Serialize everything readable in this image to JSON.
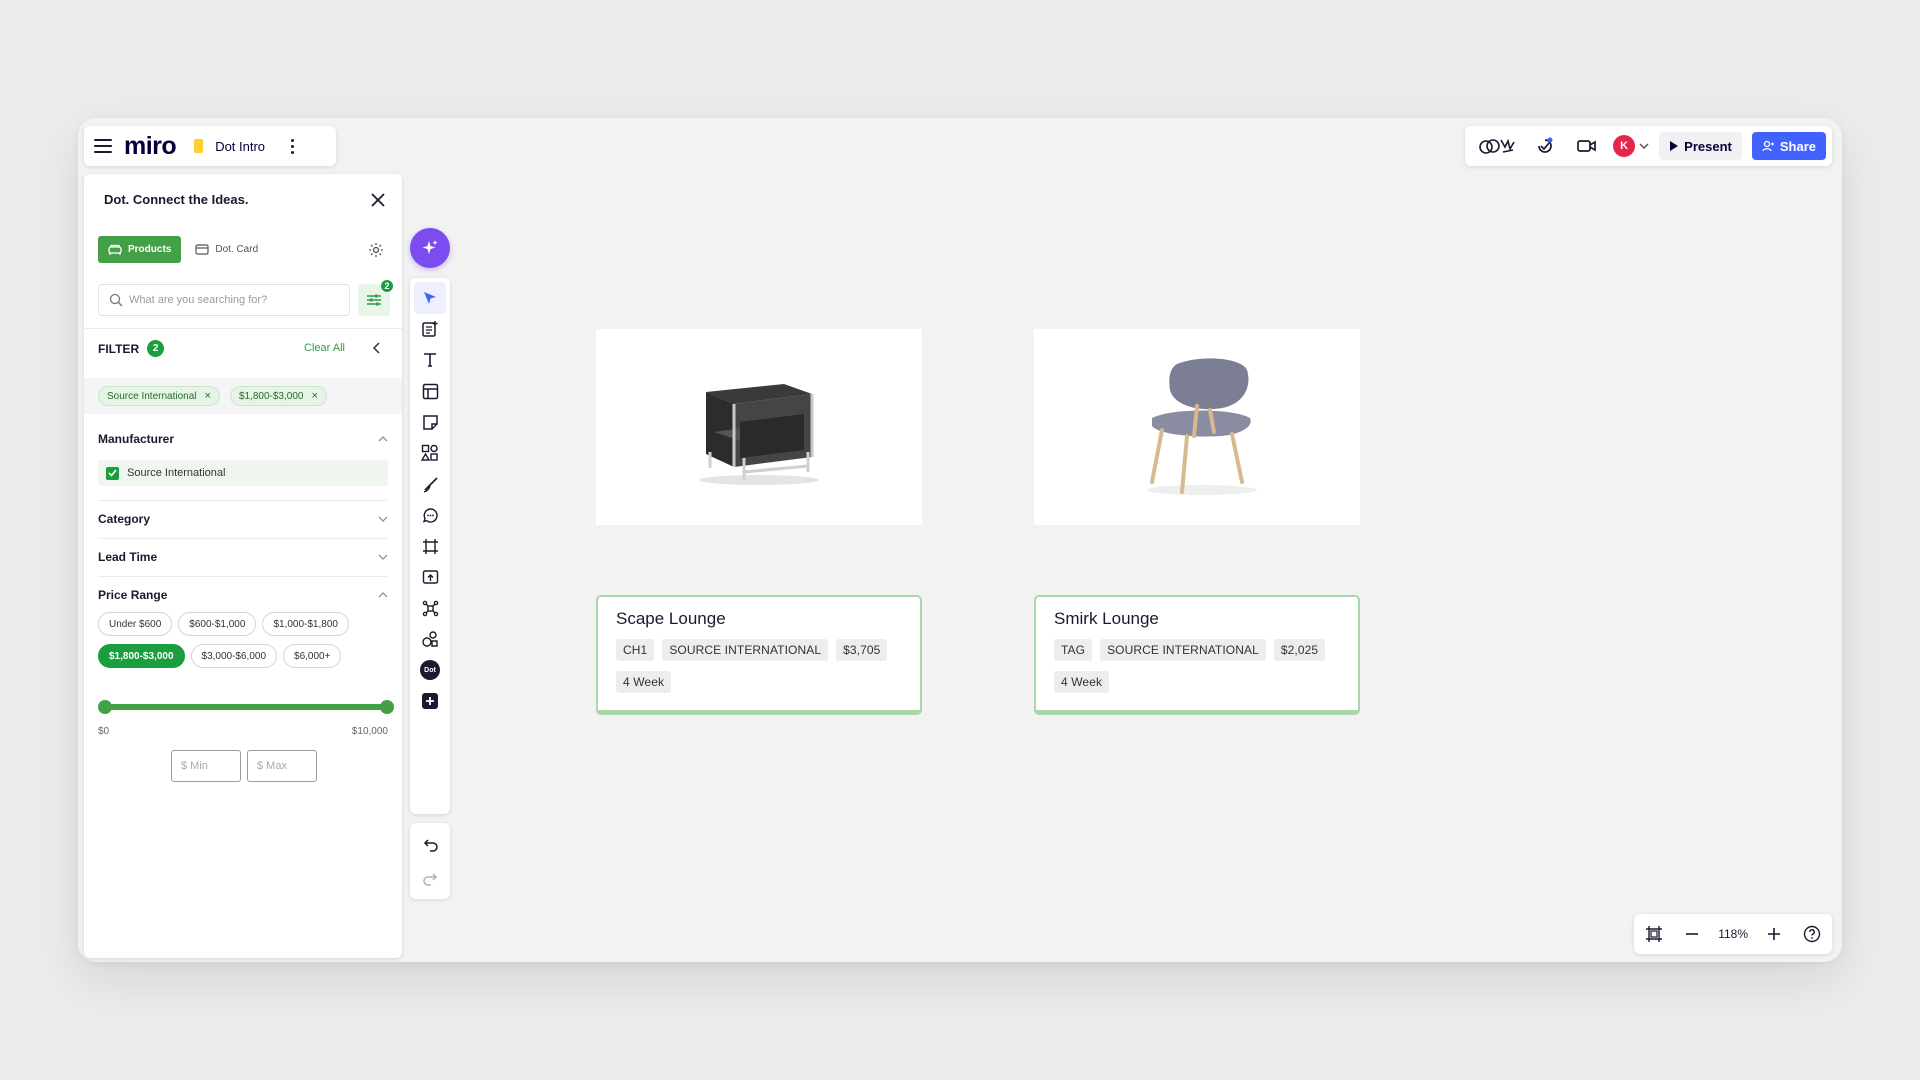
{
  "app": {
    "logo": "miro",
    "board_name": "Dot Intro"
  },
  "topbar": {
    "present_label": "Present",
    "share_label": "Share",
    "avatar_initial": "K"
  },
  "panel": {
    "title": "Dot. Connect the Ideas.",
    "tab_products": "Products",
    "tab_dot_card": "Dot. Card",
    "search_placeholder": "What are you searching for?",
    "filter_badge": "2",
    "filter_label": "FILTER",
    "filter_count": "2",
    "clear_all": "Clear All",
    "active_chips": [
      {
        "label": "Source International",
        "remove": "×"
      },
      {
        "label": "$1,800-$3,000",
        "remove": "×"
      }
    ],
    "manufacturer": {
      "label": "Manufacturer",
      "option": "Source International",
      "checked": true
    },
    "category_label": "Category",
    "lead_time_label": "Lead Time",
    "price_range": {
      "label": "Price Range",
      "chips_row1": [
        "Under $600",
        "$600-$1,000",
        "$1,000-$1,800"
      ],
      "chips_row2": [
        "$1,800-$3,000",
        "$3,000-$6,000",
        "$6,000+"
      ],
      "selected": "$1,800-$3,000",
      "slider_min_label": "$0",
      "slider_max_label": "$10,000",
      "min_placeholder": "$ Min",
      "max_placeholder": "$ Max"
    }
  },
  "toolbar": {
    "tools": [
      "select-icon",
      "template-icon",
      "text-icon",
      "table-icon",
      "sticky-note-icon",
      "shapes-icon",
      "pen-icon",
      "comment-icon",
      "frame-icon",
      "upload-icon",
      "mindmap-icon",
      "more-apps-icon",
      "dot-app-icon",
      "add-icon"
    ],
    "dot_label": "Dot"
  },
  "canvas": {
    "products": [
      {
        "name": "Scape Lounge",
        "tags": [
          "CH1",
          "SOURCE INTERNATIONAL",
          "$3,705"
        ],
        "lead": "4 Week",
        "image": "black-armchair"
      },
      {
        "name": "Smirk Lounge",
        "tags": [
          "TAG",
          "SOURCE INTERNATIONAL",
          "$2,025"
        ],
        "lead": "4 Week",
        "image": "grey-lounge-chair"
      }
    ]
  },
  "zoom": {
    "level": "118%"
  },
  "colors": {
    "accent_green": "#1b9e3e",
    "share_blue": "#4262ff",
    "ai_purple": "#7b4cf0",
    "card_border": "#a9d7ac"
  }
}
